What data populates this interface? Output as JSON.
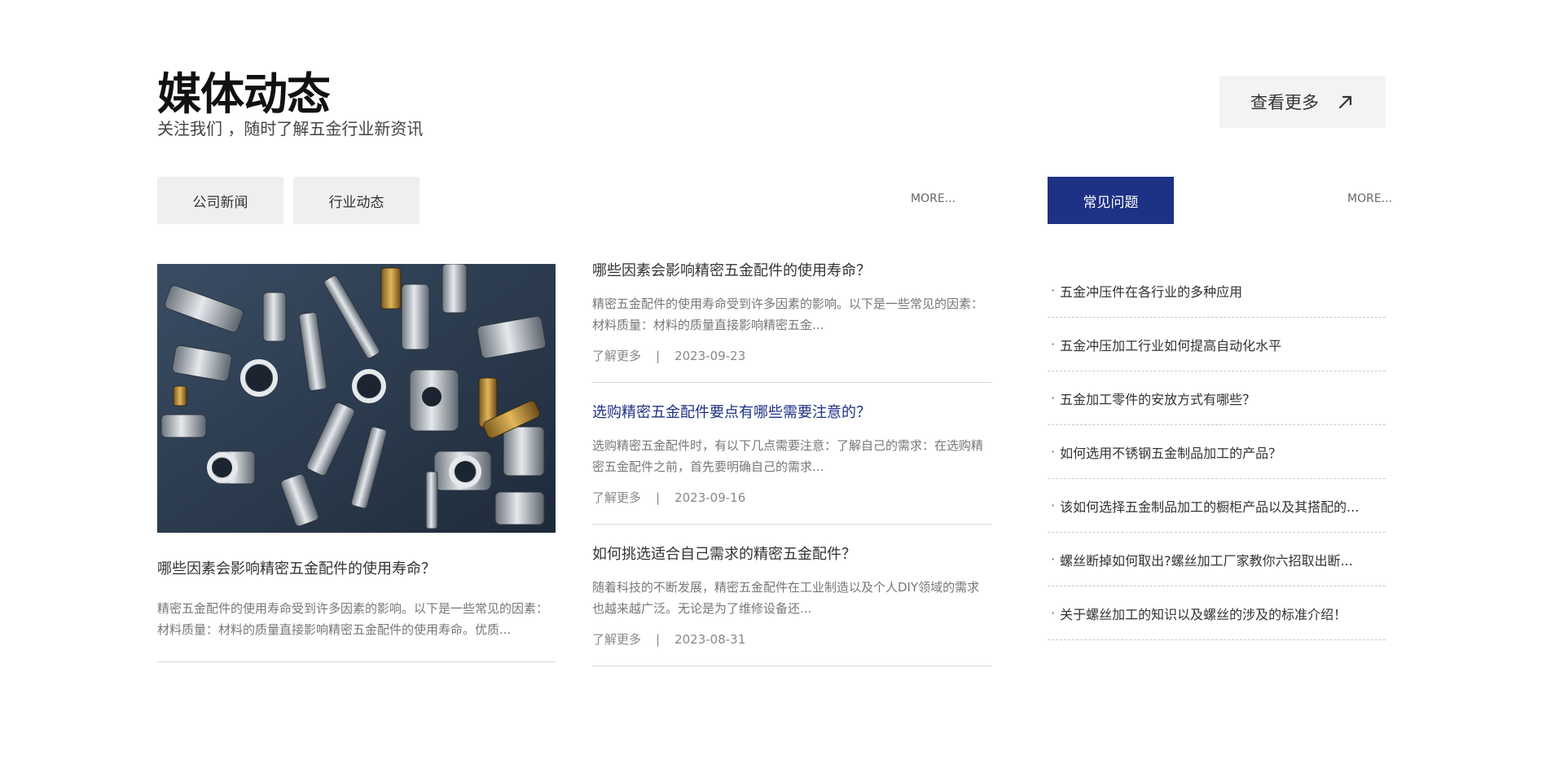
{
  "header": {
    "title": "媒体动态",
    "subtitle": "关注我们 ，随时了解五金行业新资讯",
    "view_more": "查看更多"
  },
  "tabs": [
    {
      "label": "公司新闻"
    },
    {
      "label": "行业动态"
    }
  ],
  "news_more": "MORE...",
  "faq_tab": "常见问题",
  "faq_more": "MORE...",
  "feature": {
    "title": "哪些因素会影响精密五金配件的使用寿命？",
    "desc": "精密五金配件的使用寿命受到许多因素的影响。以下是一些常见的因素：材料质量：材料的质量直接影响精密五金配件的使用寿命。优质..."
  },
  "articles": [
    {
      "title": "哪些因素会影响精密五金配件的使用寿命？",
      "desc": "精密五金配件的使用寿命受到许多因素的影响。以下是一些常见的因素：材料质量：材料的质量直接影响精密五金...",
      "more": "了解更多",
      "sep": "|",
      "date": "2023-09-23"
    },
    {
      "title": "选购精密五金配件要点有哪些需要注意的？",
      "desc": "选购精密五金配件时，有以下几点需要注意：了解自己的需求：在选购精密五金配件之前，首先要明确自己的需求...",
      "more": "了解更多",
      "sep": "|",
      "date": "2023-09-16"
    },
    {
      "title": "如何挑选适合自己需求的精密五金配件？",
      "desc": "随着科技的不断发展，精密五金配件在工业制造以及个人DIY领域的需求也越来越广泛。无论是为了维修设备还...",
      "more": "了解更多",
      "sep": "|",
      "date": "2023-08-31"
    }
  ],
  "faq": [
    "五金冲压件在各行业的多种应用",
    "五金冲压加工行业如何提高自动化水平",
    "五金加工零件的安放方式有哪些？",
    "如何选用不锈钢五金制品加工的产品？",
    "该如何选择五金制品加工的橱柜产品以及其搭配的...",
    "螺丝断掉如何取出?螺丝加工厂家教你六招取出断...",
    "关于螺丝加工的知识以及螺丝的涉及的标准介绍！"
  ],
  "faq_bullet": "·",
  "colors": {
    "accent": "#1d3185",
    "tab_bg": "#efefef",
    "button_bg": "#f3f3f3"
  },
  "icons": {
    "view_more": "arrow-up-right-icon"
  }
}
